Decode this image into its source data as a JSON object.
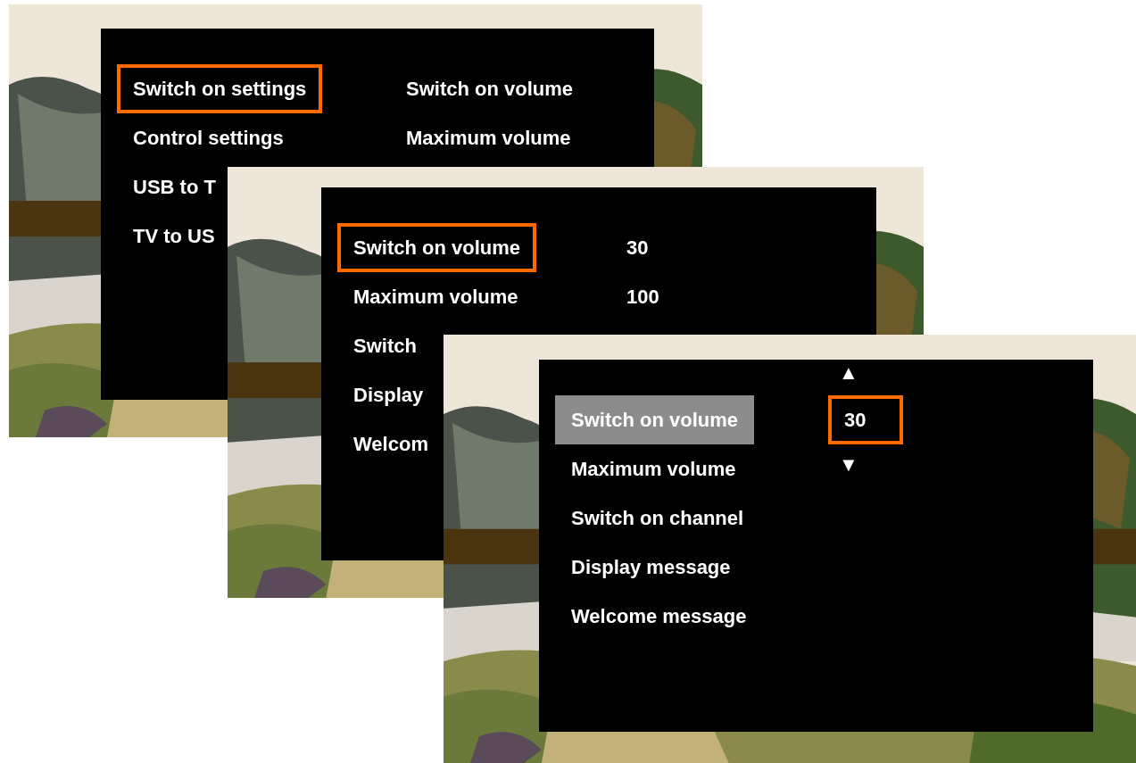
{
  "panels": [
    {
      "kind": "menu",
      "left": [
        {
          "label": "Switch on settings",
          "selected": true
        },
        {
          "label": "Control settings",
          "selected": false
        },
        {
          "label": "USB to T",
          "selected": false
        },
        {
          "label": "TV to US",
          "selected": false
        }
      ],
      "right": [
        {
          "text": "Switch on volume",
          "selected": false
        },
        {
          "text": "Maximum volume",
          "selected": false
        }
      ]
    },
    {
      "kind": "menu",
      "left": [
        {
          "label": "Switch on volume",
          "selected": true
        },
        {
          "label": "Maximum volume",
          "selected": false
        },
        {
          "label": "Switch",
          "selected": false
        },
        {
          "label": "Display",
          "selected": false
        },
        {
          "label": "Welcom",
          "selected": false
        }
      ],
      "right": [
        {
          "text": "30",
          "selected": false
        },
        {
          "text": "100",
          "selected": false
        }
      ]
    },
    {
      "kind": "edit",
      "left": [
        {
          "label": "Switch on volume",
          "selected": true
        },
        {
          "label": "Maximum volume",
          "selected": false
        },
        {
          "label": "Switch on channel",
          "selected": false
        },
        {
          "label": "Display message",
          "selected": false
        },
        {
          "label": "Welcome message",
          "selected": false
        }
      ],
      "right": [
        {
          "text": "30",
          "selected": true
        }
      ],
      "spinner": {
        "up": "▲",
        "down": "▼"
      }
    }
  ]
}
